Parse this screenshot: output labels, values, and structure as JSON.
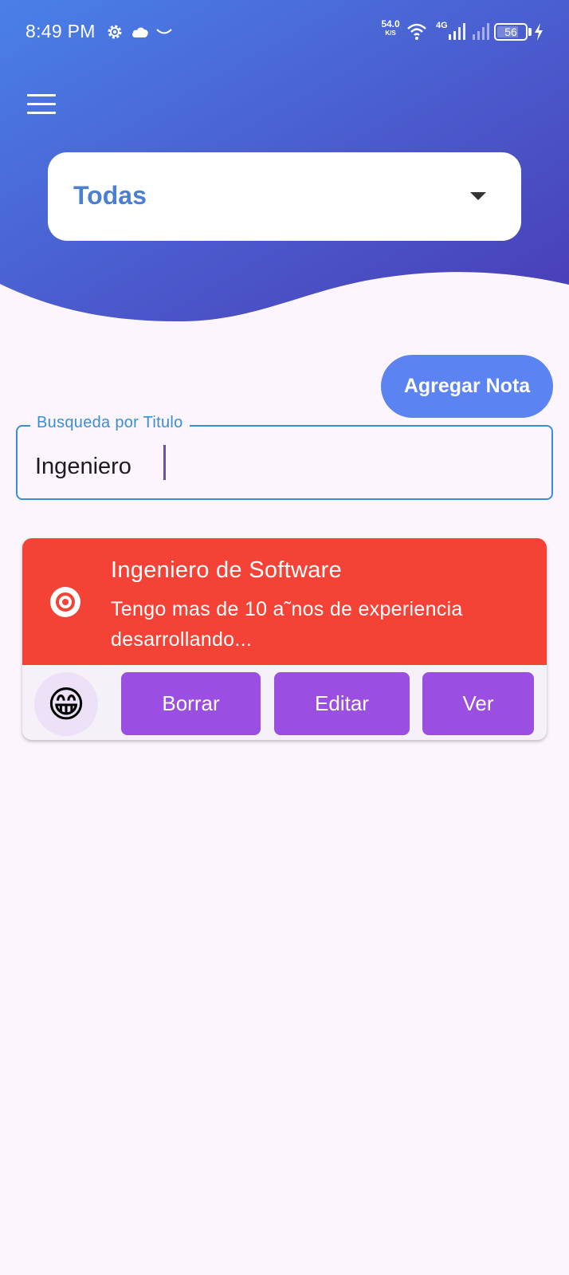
{
  "status_bar": {
    "time": "8:49 PM",
    "net_speed_value": "54.0",
    "net_speed_unit": "K/S",
    "network_type": "4G",
    "battery": "56"
  },
  "colors": {
    "header_gradient_start": "#4a7fe6",
    "header_gradient_end": "#4a3fb8",
    "accent_blue": "#5b83f1",
    "note_red": "#f44336",
    "action_purple": "#9a4fe2",
    "background": "#fcf5fd"
  },
  "filter": {
    "selected": "Todas"
  },
  "actions": {
    "add_note_label": "Agregar Nota"
  },
  "search": {
    "label": "Busqueda por Titulo",
    "value": "Ingeniero"
  },
  "notes": [
    {
      "title": "Ingeniero de Software",
      "description": "Tengo mas de 10 a˜nos de experiencia desarrollando...",
      "emoji": "😁",
      "buttons": {
        "delete": "Borrar",
        "edit": "Editar",
        "view": "Ver"
      }
    }
  ]
}
